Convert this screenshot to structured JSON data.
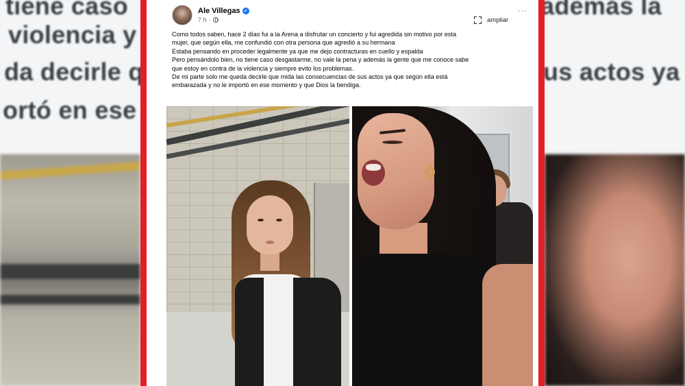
{
  "post": {
    "author": "Ale Villegas",
    "time": "7 h",
    "meta_separator": "·",
    "more_menu": "···",
    "expand_label": "ampliar",
    "body_lines": [
      "Como todos saben, hace 2 días fui a la Arena a disfrutar un concierto y fui agredida sin motivo por esta",
      "mujer, que según ella, me confundió con otra persona que agredió a su hermana",
      "Estaba pensando en proceder legalmente ya que me dejo contracturas en cuello y espalda",
      "Pero pensándolo bien, no tiene caso desgastarme, no vale la pena y además la gente que me conoce sabe",
      "que estoy en contra de la violencia y siempre evito los problemas.",
      "De mi parte solo me queda decirle que mida las consecuencias de sus actos ya que según ella está",
      "embarazada y no le importó en ese momento y que Dios la bendiga."
    ]
  },
  "background_left": {
    "lines": [
      "tiene caso",
      "violencia y",
      "da decirle q",
      "ortó en ese r"
    ]
  },
  "background_right": {
    "lines": [
      "además la",
      "us actos ya"
    ]
  },
  "icons": {
    "verified": "verified-badge-icon",
    "globe": "globe-icon",
    "expand": "expand-icon",
    "more": "more-options-icon"
  },
  "colors": {
    "frame_red": "#e21f26",
    "verified_blue": "#1877f2",
    "text_primary": "#050505",
    "text_secondary": "#65676b"
  }
}
